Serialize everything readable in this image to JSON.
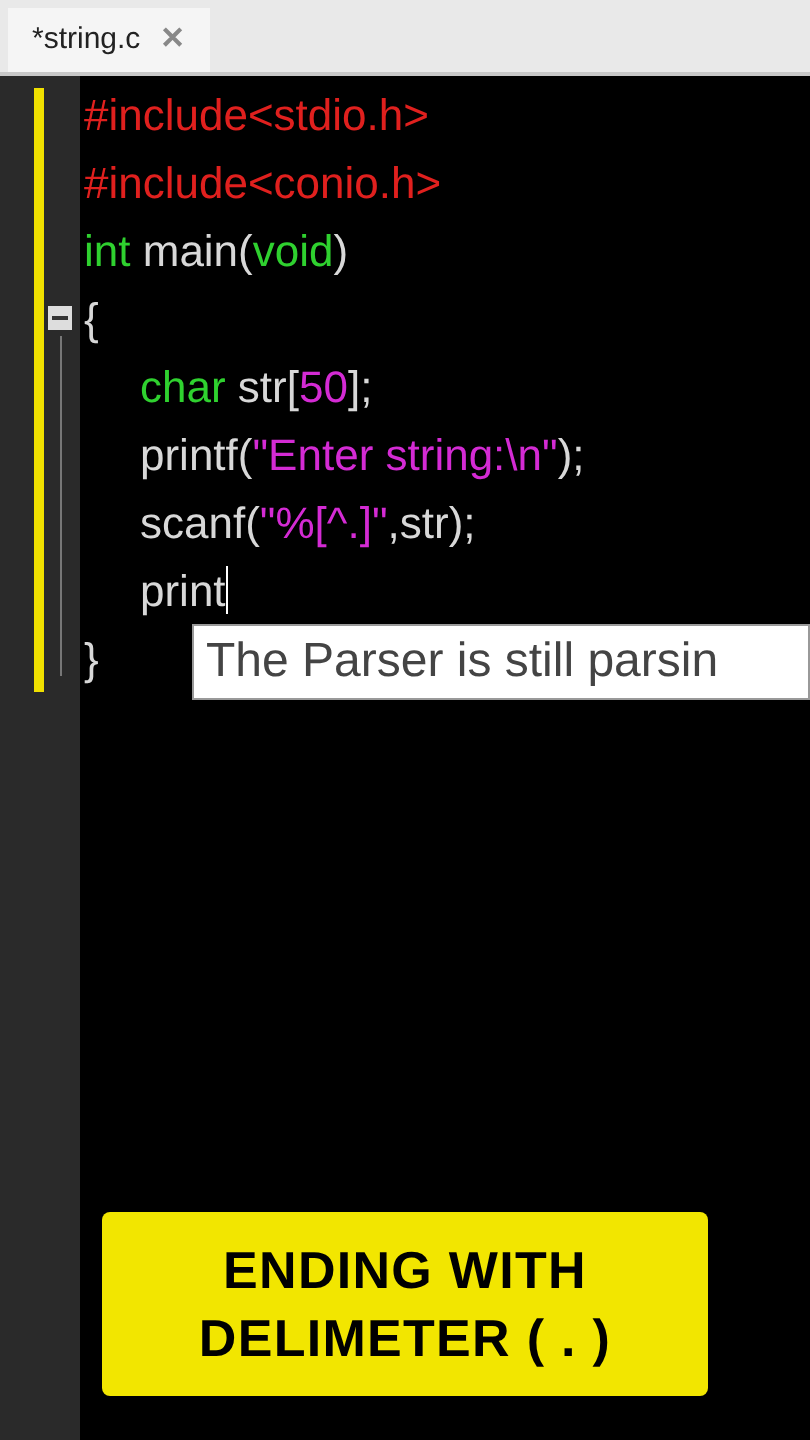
{
  "tab": {
    "label": "*string.c",
    "close": "✕"
  },
  "editor": {
    "lines": [
      {
        "kind": "top",
        "fold": false,
        "caret": false,
        "tokens": [
          {
            "text": "#include<stdio.h>",
            "kind": "preproc"
          }
        ]
      },
      {
        "kind": "top",
        "fold": false,
        "caret": false,
        "tokens": [
          {
            "text": "#include<conio.h>",
            "kind": "preproc"
          }
        ]
      },
      {
        "kind": "top",
        "fold": false,
        "caret": false,
        "tokens": [
          {
            "text": "int",
            "kind": "keyword"
          },
          {
            "text": " main(",
            "kind": "plain"
          },
          {
            "text": "void",
            "kind": "keyword"
          },
          {
            "text": ")",
            "kind": "plain"
          }
        ]
      },
      {
        "kind": "top",
        "fold": true,
        "caret": false,
        "tokens": [
          {
            "text": "{",
            "kind": "plain"
          }
        ]
      },
      {
        "kind": "body",
        "fold": false,
        "caret": false,
        "tokens": [
          {
            "text": "char",
            "kind": "keyword"
          },
          {
            "text": " str[",
            "kind": "plain"
          },
          {
            "text": "50",
            "kind": "number"
          },
          {
            "text": "];",
            "kind": "plain"
          }
        ]
      },
      {
        "kind": "body",
        "fold": false,
        "caret": false,
        "tokens": [
          {
            "text": "printf(",
            "kind": "plain"
          },
          {
            "text": "\"Enter string:\\n\"",
            "kind": "string"
          },
          {
            "text": ");",
            "kind": "plain"
          }
        ]
      },
      {
        "kind": "body",
        "fold": false,
        "caret": false,
        "tokens": [
          {
            "text": "scanf(",
            "kind": "plain"
          },
          {
            "text": "\"%[^.]\"",
            "kind": "string"
          },
          {
            "text": ",str);",
            "kind": "plain"
          }
        ]
      },
      {
        "kind": "body",
        "fold": false,
        "caret": true,
        "tokens": [
          {
            "text": "print",
            "kind": "plain"
          }
        ]
      },
      {
        "kind": "top",
        "fold": false,
        "caret": false,
        "tokens": [
          {
            "text": "}",
            "kind": "plain"
          }
        ]
      }
    ],
    "tooltip": "The Parser is still parsin"
  },
  "caption": "ENDING WITH DELIMETER ( . )"
}
